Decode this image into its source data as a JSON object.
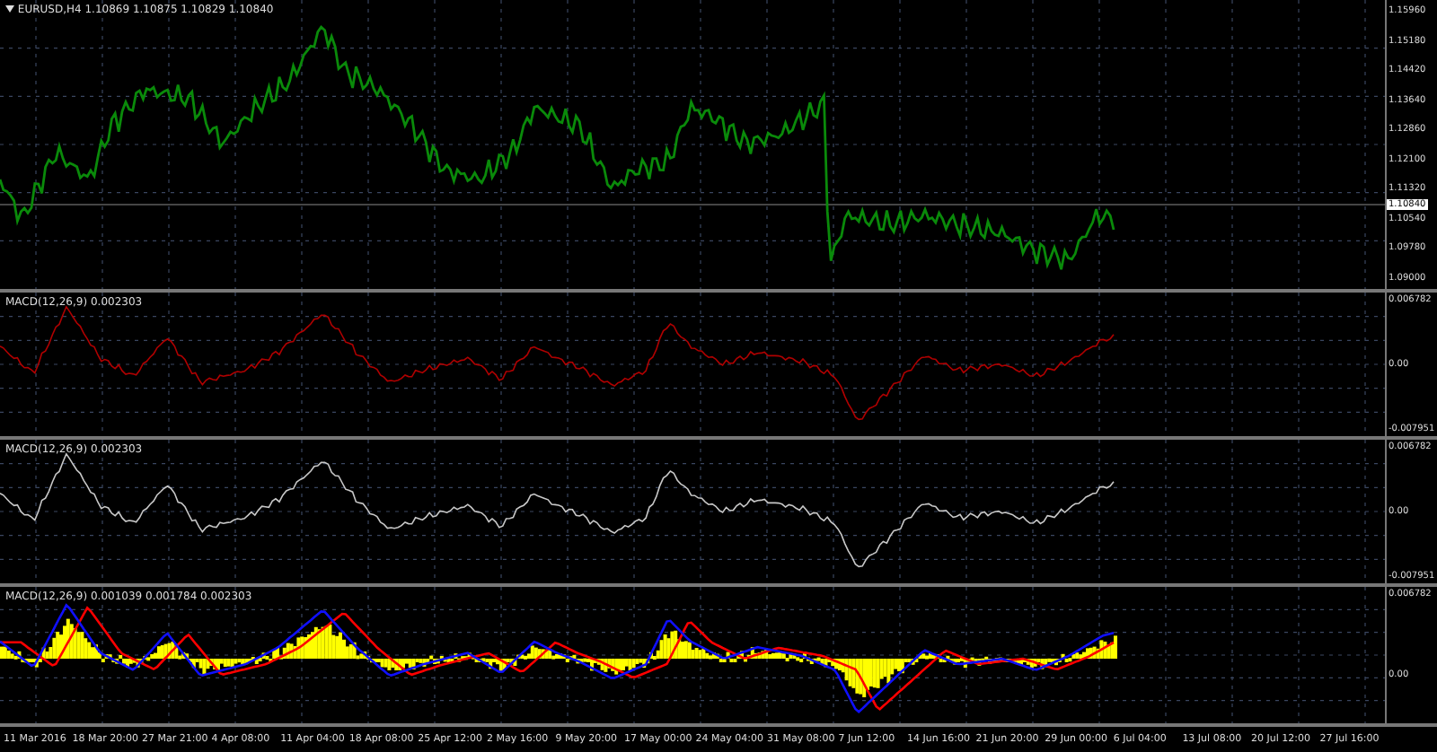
{
  "main_chart": {
    "title": "EURUSD,H4  1.10869 1.10875 1.10829 1.10840",
    "price_labels": [
      "1.15960",
      "1.15180",
      "1.14420",
      "1.13640",
      "1.12860",
      "1.12100",
      "1.11320",
      "1.10540",
      "1.09780",
      "1.09000"
    ],
    "current_price": "1.10840"
  },
  "indicator_panels": [
    {
      "kind": "line",
      "title": "MACD(12,26,9) 0.002303",
      "color": "#b00000",
      "labels": [
        "0.006782",
        "0.00",
        "-0.007951"
      ]
    },
    {
      "kind": "line",
      "title": "MACD(12,26,9) 0.002303",
      "color": "#c8c8c8",
      "labels": [
        "0.006782",
        "0.00",
        "-0.007951"
      ]
    },
    {
      "kind": "histogram",
      "title": "MACD(12,26,9) 0.001039 0.001784 0.002303",
      "labels": [
        "0.006782",
        "0.00"
      ]
    }
  ],
  "time_labels": [
    "11 Mar 2016",
    "18 Mar 20:00",
    "27 Mar 21:00",
    "4 Apr 08:00",
    "11 Apr 04:00",
    "18 Apr 08:00",
    "25 Apr 12:00",
    "2 May 16:00",
    "9 May 20:00",
    "17 May 00:00",
    "24 May 04:00",
    "31 May 08:00",
    "7 Jun 12:00",
    "14 Jun 16:00",
    "21 Jun 20:00",
    "29 Jun 00:00",
    "6 Jul 04:00",
    "13 Jul 08:00",
    "20 Jul 12:00",
    "27 Jul 16:00"
  ]
}
